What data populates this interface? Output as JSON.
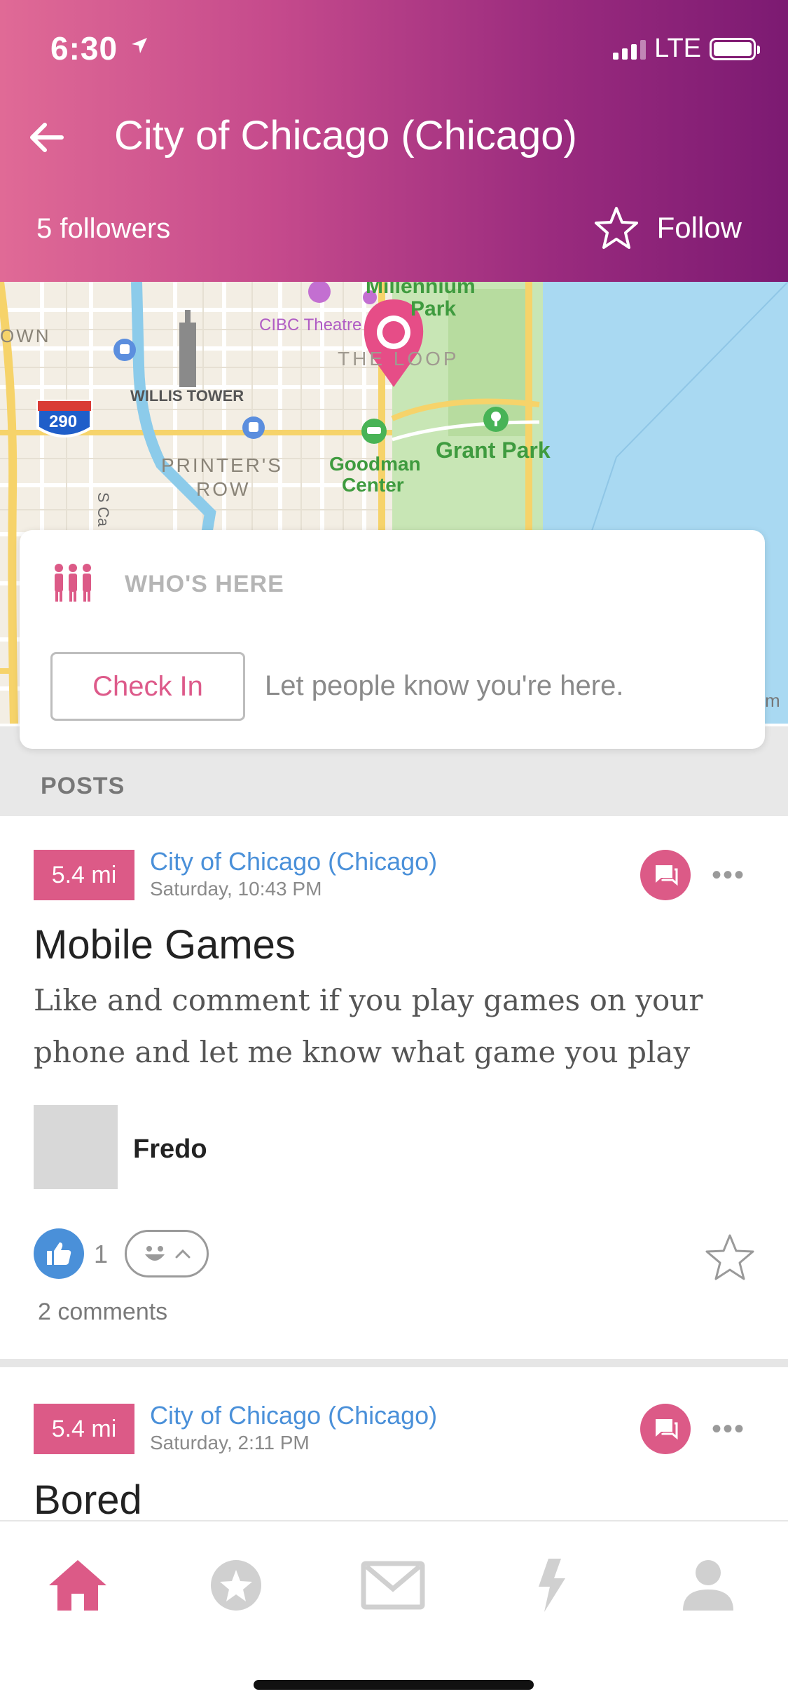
{
  "status_bar": {
    "time": "6:30",
    "network": "LTE"
  },
  "header": {
    "title": "City of Chicago (Chicago)",
    "followers": "5 followers",
    "follow_label": "Follow"
  },
  "map": {
    "labels": {
      "millennium": "Millennium",
      "park": "Park",
      "cibc": "CIBC Theatre",
      "loop": "THE LOOP",
      "own": "OWN",
      "willis": "WILLIS TOWER",
      "interstate": "290",
      "printers": "PRINTER'S",
      "row": "ROW",
      "goodman": "Goodman",
      "center": "Center",
      "grant_park": "Grant Park",
      "street": "S Ca",
      "edge": "m"
    }
  },
  "whos_here": {
    "label": "WHO'S HERE",
    "checkin_label": "Check In",
    "hint": "Let people know you're here."
  },
  "posts_section": {
    "label": "POSTS"
  },
  "posts": [
    {
      "distance": "5.4 mi",
      "place": "City of Chicago (Chicago)",
      "time": "Saturday, 10:43 PM",
      "title": "Mobile Games",
      "body": "Like and comment if you play games on your phone and let me know what game you play",
      "author": "Fredo",
      "likes": "1",
      "comments": "2 comments",
      "more": "•••"
    },
    {
      "distance": "5.4 mi",
      "place": "City of Chicago (Chicago)",
      "time": "Saturday, 2:11 PM",
      "title": "Bored",
      "more": "•••"
    }
  ],
  "tabbar": {
    "items": [
      "home-icon",
      "star-icon",
      "mail-icon",
      "bolt-icon",
      "profile-icon"
    ],
    "active": "home-icon"
  },
  "colors": {
    "accent": "#dc5a87",
    "link": "#4a90d9",
    "header_start": "#e06a96",
    "header_end": "#7c1a72"
  }
}
